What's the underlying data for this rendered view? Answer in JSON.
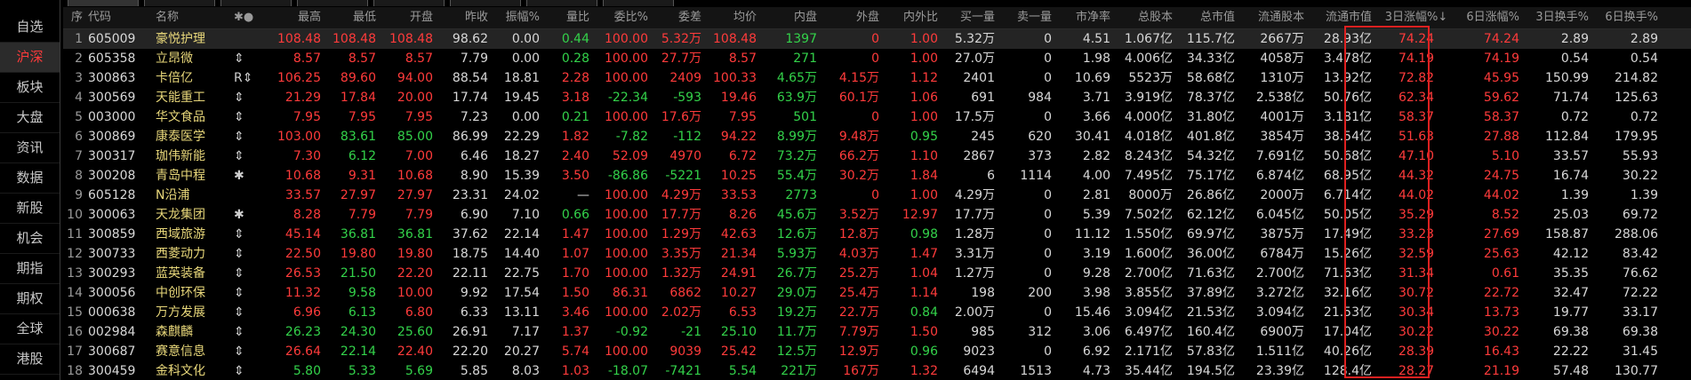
{
  "sidebar": {
    "items": [
      {
        "label": "自选",
        "active": false
      },
      {
        "label": "沪深",
        "active": true
      },
      {
        "label": "板块",
        "active": false
      },
      {
        "label": "大盘",
        "active": false
      },
      {
        "label": "资讯",
        "active": false
      },
      {
        "label": "数据",
        "active": false
      },
      {
        "label": "新股",
        "active": false
      },
      {
        "label": "机会",
        "active": false
      },
      {
        "label": "期指",
        "active": false
      },
      {
        "label": "期权",
        "active": false
      },
      {
        "label": "全球",
        "active": false
      },
      {
        "label": "港股",
        "active": false
      }
    ]
  },
  "table": {
    "headers": {
      "seq": "序",
      "code": "代码",
      "name": "名称",
      "flag": "✱●",
      "high": "最高",
      "low": "最低",
      "open": "开盘",
      "prev_close": "昨收",
      "amplitude": "振幅%",
      "vol_ratio": "量比",
      "wei_bi": "委比%",
      "wei_cha": "委差",
      "avg_price": "均价",
      "inner": "内盘",
      "outer": "外盘",
      "in_out_ratio": "内外比",
      "buy_qty": "买一量",
      "sell_qty": "卖一量",
      "pb": "市净率",
      "total_shares": "总股本",
      "total_value": "总市值",
      "float_shares": "流通股本",
      "float_value": "流通市值",
      "d3": "3日涨幅%↓",
      "d6": "6日涨幅%",
      "t3": "3日换手%",
      "t6": "6日换手%"
    },
    "rows": [
      {
        "seq": "1",
        "code": "605009",
        "name": "豪悦护理",
        "flag": "",
        "high": "108.48",
        "low": "108.48",
        "open": "108.48",
        "prev": "98.62",
        "amp": "0.00",
        "vr": "0.44",
        "wb": "100.00",
        "wc": "5.32万",
        "avg": "108.48",
        "inner": "1397",
        "outer": "0",
        "ratio": "1.00",
        "buy": "5.32万",
        "sell": "0",
        "pb": "4.51",
        "tcap": "1.067亿",
        "tval": "115.7亿",
        "fcap": "2667万",
        "fval": "28.93亿",
        "d3": "74.24",
        "d6": "74.24",
        "t3": "2.89",
        "t6": "2.89"
      },
      {
        "seq": "2",
        "code": "605358",
        "name": "立昂微",
        "flag": "⇕",
        "high": "8.57",
        "low": "8.57",
        "open": "8.57",
        "prev": "7.79",
        "amp": "0.00",
        "vr": "0.28",
        "wb": "100.00",
        "wc": "27.7万",
        "avg": "8.57",
        "inner": "271",
        "outer": "0",
        "ratio": "1.00",
        "buy": "27.0万",
        "sell": "0",
        "pb": "1.98",
        "tcap": "4.006亿",
        "tval": "34.33亿",
        "fcap": "4058万",
        "fval": "3.478亿",
        "d3": "74.19",
        "d6": "74.19",
        "t3": "0.54",
        "t6": "0.54"
      },
      {
        "seq": "3",
        "code": "300863",
        "name": "卡倍亿",
        "flag": "R⇕",
        "high": "106.25",
        "low": "89.60",
        "open": "94.00",
        "prev": "88.54",
        "amp": "18.81",
        "vr": "2.28",
        "wb": "100.00",
        "wc": "2409",
        "avg": "100.33",
        "inner": "4.65万",
        "outer": "4.15万",
        "ratio": "1.12",
        "buy": "2401",
        "sell": "0",
        "pb": "10.69",
        "tcap": "5523万",
        "tval": "58.68亿",
        "fcap": "1310万",
        "fval": "13.92亿",
        "d3": "72.82",
        "d6": "45.95",
        "t3": "150.99",
        "t6": "214.82"
      },
      {
        "seq": "4",
        "code": "300569",
        "name": "天能重工",
        "flag": "⇕",
        "high": "21.29",
        "low": "17.84",
        "open": "20.00",
        "prev": "17.74",
        "amp": "19.45",
        "vr": "3.18",
        "wb": "-22.34",
        "wc": "-593",
        "avg": "19.46",
        "inner": "63.9万",
        "outer": "60.1万",
        "ratio": "1.06",
        "buy": "691",
        "sell": "984",
        "pb": "3.71",
        "tcap": "3.919亿",
        "tval": "78.37亿",
        "fcap": "2.538亿",
        "fval": "50.76亿",
        "d3": "62.34",
        "d6": "59.62",
        "t3": "71.74",
        "t6": "125.63"
      },
      {
        "seq": "5",
        "code": "003000",
        "name": "华文食品",
        "flag": "⇕",
        "high": "7.95",
        "low": "7.95",
        "open": "7.95",
        "prev": "7.23",
        "amp": "0.00",
        "vr": "0.21",
        "wb": "100.00",
        "wc": "17.6万",
        "avg": "7.95",
        "inner": "501",
        "outer": "0",
        "ratio": "1.00",
        "buy": "17.5万",
        "sell": "0",
        "pb": "3.66",
        "tcap": "4.000亿",
        "tval": "31.80亿",
        "fcap": "4001万",
        "fval": "3.181亿",
        "d3": "58.37",
        "d6": "58.37",
        "t3": "0.72",
        "t6": "0.72"
      },
      {
        "seq": "6",
        "code": "300869",
        "name": "康泰医学",
        "flag": "⇕",
        "high": "103.00",
        "low": "83.61",
        "open": "85.00",
        "prev": "86.99",
        "amp": "22.29",
        "vr": "1.82",
        "wb": "-7.82",
        "wc": "-112",
        "avg": "94.22",
        "inner": "8.99万",
        "outer": "9.48万",
        "ratio": "0.95",
        "buy": "245",
        "sell": "620",
        "pb": "30.41",
        "tcap": "4.018亿",
        "tval": "401.8亿",
        "fcap": "3854万",
        "fval": "38.54亿",
        "d3": "51.63",
        "d6": "27.88",
        "t3": "112.84",
        "t6": "179.95"
      },
      {
        "seq": "7",
        "code": "300317",
        "name": "珈伟新能",
        "flag": "⇕",
        "high": "7.30",
        "low": "6.12",
        "open": "7.00",
        "prev": "6.46",
        "amp": "18.27",
        "vr": "2.40",
        "wb": "52.09",
        "wc": "4970",
        "avg": "6.72",
        "inner": "73.2万",
        "outer": "66.2万",
        "ratio": "1.10",
        "buy": "2867",
        "sell": "373",
        "pb": "2.82",
        "tcap": "8.243亿",
        "tval": "54.32亿",
        "fcap": "7.691亿",
        "fval": "50.68亿",
        "d3": "47.10",
        "d6": "5.10",
        "t3": "33.57",
        "t6": "55.93"
      },
      {
        "seq": "8",
        "code": "300208",
        "name": "青岛中程",
        "flag": "✱",
        "high": "10.68",
        "low": "9.31",
        "open": "10.68",
        "prev": "8.90",
        "amp": "15.39",
        "vr": "3.50",
        "wb": "-86.86",
        "wc": "-5221",
        "avg": "10.25",
        "inner": "55.4万",
        "outer": "30.2万",
        "ratio": "1.84",
        "buy": "6",
        "sell": "1114",
        "pb": "4.00",
        "tcap": "7.495亿",
        "tval": "75.17亿",
        "fcap": "6.874亿",
        "fval": "68.95亿",
        "d3": "44.32",
        "d6": "24.75",
        "t3": "16.74",
        "t6": "30.22"
      },
      {
        "seq": "9",
        "code": "605128",
        "name": "N沿浦",
        "flag": "",
        "high": "33.57",
        "low": "27.97",
        "open": "27.97",
        "prev": "23.31",
        "amp": "24.02",
        "vr": "—",
        "wb": "100.00",
        "wc": "4.29万",
        "avg": "33.53",
        "inner": "2773",
        "outer": "0",
        "ratio": "1.00",
        "buy": "4.29万",
        "sell": "0",
        "pb": "2.81",
        "tcap": "8000万",
        "tval": "26.86亿",
        "fcap": "2000万",
        "fval": "6.714亿",
        "d3": "44.02",
        "d6": "44.02",
        "t3": "1.39",
        "t6": "1.39"
      },
      {
        "seq": "10",
        "code": "300063",
        "name": "天龙集团",
        "flag": "✱",
        "high": "8.28",
        "low": "7.79",
        "open": "7.79",
        "prev": "6.90",
        "amp": "7.10",
        "vr": "0.66",
        "wb": "100.00",
        "wc": "17.7万",
        "avg": "8.26",
        "inner": "45.6万",
        "outer": "3.52万",
        "ratio": "12.97",
        "buy": "17.7万",
        "sell": "0",
        "pb": "5.39",
        "tcap": "7.502亿",
        "tval": "62.12亿",
        "fcap": "6.045亿",
        "fval": "50.05亿",
        "d3": "35.29",
        "d6": "8.52",
        "t3": "25.03",
        "t6": "69.72"
      },
      {
        "seq": "11",
        "code": "300859",
        "name": "西域旅游",
        "flag": "⇕",
        "high": "45.14",
        "low": "36.81",
        "open": "36.81",
        "prev": "37.62",
        "amp": "22.14",
        "vr": "1.47",
        "wb": "100.00",
        "wc": "1.29万",
        "avg": "42.63",
        "inner": "12.6万",
        "outer": "12.8万",
        "ratio": "0.98",
        "buy": "1.28万",
        "sell": "0",
        "pb": "11.12",
        "tcap": "1.550亿",
        "tval": "69.97亿",
        "fcap": "3875万",
        "fval": "17.49亿",
        "d3": "33.23",
        "d6": "27.69",
        "t3": "158.87",
        "t6": "288.06"
      },
      {
        "seq": "12",
        "code": "300733",
        "name": "西菱动力",
        "flag": "⇕",
        "high": "22.50",
        "low": "19.80",
        "open": "19.80",
        "prev": "18.75",
        "amp": "14.40",
        "vr": "1.07",
        "wb": "100.00",
        "wc": "3.35万",
        "avg": "21.34",
        "inner": "5.93万",
        "outer": "4.03万",
        "ratio": "1.47",
        "buy": "3.31万",
        "sell": "0",
        "pb": "3.19",
        "tcap": "1.600亿",
        "tval": "36.00亿",
        "fcap": "6784万",
        "fval": "15.26亿",
        "d3": "32.59",
        "d6": "25.63",
        "t3": "42.12",
        "t6": "83.42"
      },
      {
        "seq": "13",
        "code": "300293",
        "name": "蓝英装备",
        "flag": "⇕",
        "high": "26.53",
        "low": "21.50",
        "open": "22.20",
        "prev": "22.11",
        "amp": "22.75",
        "vr": "1.70",
        "wb": "100.00",
        "wc": "1.32万",
        "avg": "24.91",
        "inner": "26.7万",
        "outer": "25.2万",
        "ratio": "1.04",
        "buy": "1.27万",
        "sell": "0",
        "pb": "9.28",
        "tcap": "2.700亿",
        "tval": "71.63亿",
        "fcap": "2.700亿",
        "fval": "71.63亿",
        "d3": "31.34",
        "d6": "0.61",
        "t3": "35.35",
        "t6": "76.62"
      },
      {
        "seq": "14",
        "code": "300056",
        "name": "中创环保",
        "flag": "⇕",
        "high": "11.32",
        "low": "9.58",
        "open": "10.00",
        "prev": "9.92",
        "amp": "17.54",
        "vr": "1.50",
        "wb": "86.31",
        "wc": "6862",
        "avg": "10.27",
        "inner": "29.0万",
        "outer": "25.4万",
        "ratio": "1.14",
        "buy": "198",
        "sell": "200",
        "pb": "3.98",
        "tcap": "3.855亿",
        "tval": "37.89亿",
        "fcap": "3.272亿",
        "fval": "32.16亿",
        "d3": "30.72",
        "d6": "22.72",
        "t3": "32.47",
        "t6": "72.22"
      },
      {
        "seq": "15",
        "code": "000638",
        "name": "万方发展",
        "flag": "⇕",
        "high": "6.96",
        "low": "6.13",
        "open": "6.80",
        "prev": "6.33",
        "amp": "13.11",
        "vr": "3.46",
        "wb": "100.00",
        "wc": "2.02万",
        "avg": "6.53",
        "inner": "19.2万",
        "outer": "22.7万",
        "ratio": "0.84",
        "buy": "2.00万",
        "sell": "0",
        "pb": "15.46",
        "tcap": "3.094亿",
        "tval": "21.53亿",
        "fcap": "3.094亿",
        "fval": "21.53亿",
        "d3": "30.34",
        "d6": "13.73",
        "t3": "19.77",
        "t6": "33.17"
      },
      {
        "seq": "16",
        "code": "002984",
        "name": "森麒麟",
        "flag": "⇕",
        "high": "26.23",
        "low": "24.30",
        "open": "25.60",
        "prev": "26.91",
        "amp": "7.17",
        "vr": "1.37",
        "wb": "-0.92",
        "wc": "-21",
        "avg": "25.10",
        "inner": "11.7万",
        "outer": "7.79万",
        "ratio": "1.50",
        "buy": "985",
        "sell": "312",
        "pb": "3.06",
        "tcap": "6.497亿",
        "tval": "160.4亿",
        "fcap": "6900万",
        "fval": "17.04亿",
        "d3": "30.22",
        "d6": "30.22",
        "t3": "69.38",
        "t6": "69.38"
      },
      {
        "seq": "17",
        "code": "300687",
        "name": "赛意信息",
        "flag": "⇕",
        "high": "26.64",
        "low": "22.14",
        "open": "22.40",
        "prev": "22.20",
        "amp": "20.27",
        "vr": "5.74",
        "wb": "100.00",
        "wc": "9039",
        "avg": "25.42",
        "inner": "12.5万",
        "outer": "12.9万",
        "ratio": "0.96",
        "buy": "9023",
        "sell": "0",
        "pb": "6.92",
        "tcap": "2.171亿",
        "tval": "57.83亿",
        "fcap": "1.511亿",
        "fval": "40.26亿",
        "d3": "28.39",
        "d6": "16.43",
        "t3": "22.22",
        "t6": "31.45"
      },
      {
        "seq": "18",
        "code": "300459",
        "name": "金科文化",
        "flag": "⇕",
        "high": "5.80",
        "low": "5.33",
        "open": "5.69",
        "prev": "5.85",
        "amp": "8.03",
        "vr": "1.03",
        "wb": "-18.07",
        "wc": "-7421",
        "avg": "5.54",
        "inner": "221万",
        "outer": "167万",
        "ratio": "1.32",
        "buy": "6494",
        "sell": "1513",
        "pb": "4.73",
        "tcap": "35.44亿",
        "tval": "194.5亿",
        "fcap": "23.39亿",
        "fval": "128.4亿",
        "d3": "28.27",
        "d6": "21.19",
        "t3": "57.48",
        "t6": "130.77"
      }
    ]
  },
  "colors": {
    "up": "#ff3b3b",
    "down": "#33d24a",
    "neutral": "#d8d8d8",
    "name": "#e8d77a",
    "highlight_box": "#e02020"
  }
}
